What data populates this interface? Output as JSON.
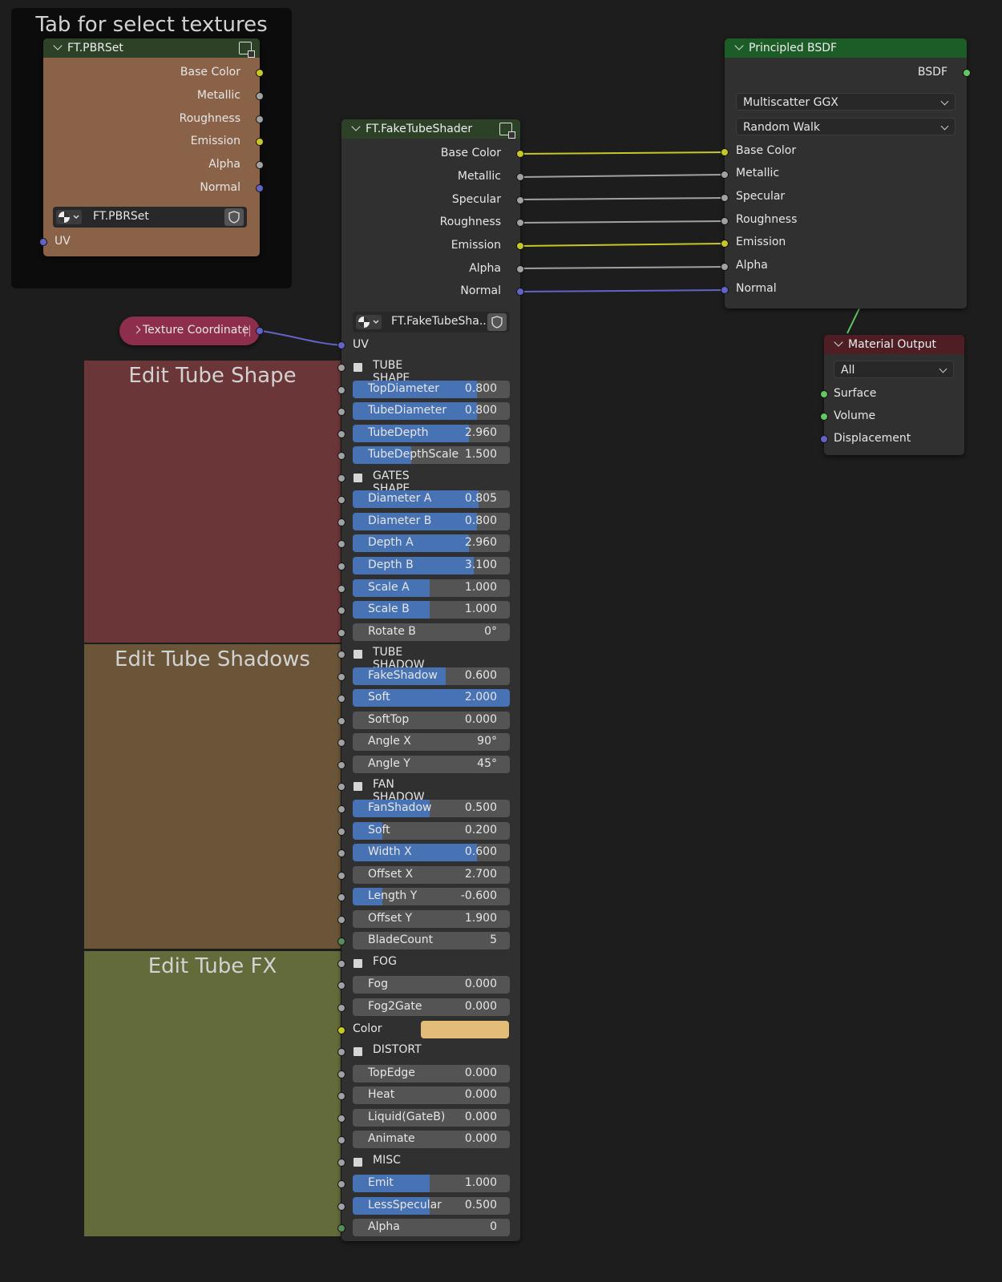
{
  "frames": {
    "textures_label": "Tab for select textures",
    "tube_shape_label": "Edit Tube Shape",
    "tube_shadows_label": "Edit Tube Shadows",
    "tube_fx_label": "Edit Tube FX"
  },
  "pbrset": {
    "title": "FT.PBRSet",
    "outputs": [
      "Base Color",
      "Metallic",
      "Roughness",
      "Emission",
      "Alpha",
      "Normal"
    ],
    "datablock": "FT.PBRSet",
    "input_uv": "UV"
  },
  "texcoord": {
    "title": "Texture Coordinate"
  },
  "faketube": {
    "title": "FT.FakeTubeShader",
    "outputs": [
      "Base Color",
      "Metallic",
      "Specular",
      "Roughness",
      "Emission",
      "Alpha",
      "Normal"
    ],
    "datablock": "FT.FakeTubeSha...",
    "input_uv": "UV",
    "tube_shape": {
      "title": "TUBE SHAPE",
      "fields": [
        {
          "label": "TopDiameter",
          "value": "0.800",
          "fill": 0.79
        },
        {
          "label": "TubeDiameter",
          "value": "0.800",
          "fill": 0.79
        },
        {
          "label": "TubeDepth",
          "value": "2.960",
          "fill": 0.74
        },
        {
          "label": "TubeDepthScale",
          "value": "1.500",
          "fill": 0.37
        }
      ]
    },
    "gates_shape": {
      "title": "GATES SHAPE",
      "fields": [
        {
          "label": "Diameter A",
          "value": "0.805",
          "fill": 0.8
        },
        {
          "label": "Diameter B",
          "value": "0.800",
          "fill": 0.79
        },
        {
          "label": "Depth A",
          "value": "2.960",
          "fill": 0.74
        },
        {
          "label": "Depth B",
          "value": "3.100",
          "fill": 0.77
        },
        {
          "label": "Scale A",
          "value": "1.000",
          "fill": 0.49
        },
        {
          "label": "Scale B",
          "value": "1.000",
          "fill": 0.49
        },
        {
          "label": "Rotate B",
          "value": "0°",
          "fill": 0
        }
      ]
    },
    "tube_shadow": {
      "title": "TUBE SHADOW",
      "fields": [
        {
          "label": "FakeShadow",
          "value": "0.600",
          "fill": 0.59
        },
        {
          "label": "Soft",
          "value": "2.000",
          "fill": 1.0
        },
        {
          "label": "SoftTop",
          "value": "0.000",
          "fill": 0
        },
        {
          "label": "Angle X",
          "value": "90°",
          "fill": 0
        },
        {
          "label": "Angle Y",
          "value": "45°",
          "fill": 0
        }
      ]
    },
    "fan_shadow": {
      "title": "FAN SHADOW",
      "fields": [
        {
          "label": "FanShadow",
          "value": "0.500",
          "fill": 0.49
        },
        {
          "label": "Soft",
          "value": "0.200",
          "fill": 0.19
        },
        {
          "label": "Width X",
          "value": "0.600",
          "fill": 0.79
        },
        {
          "label": "Offset X",
          "value": "2.700",
          "fill": 0
        },
        {
          "label": "Length Y",
          "value": "-0.600",
          "fill": 0.19
        },
        {
          "label": "Offset Y",
          "value": "1.900",
          "fill": 0
        },
        {
          "label": "BladeCount",
          "value": "5",
          "fill": 0
        }
      ]
    },
    "fog": {
      "title": "FOG",
      "fields": [
        {
          "label": "Fog",
          "value": "0.000",
          "fill": 0
        },
        {
          "label": "Fog2Gate",
          "value": "0.000",
          "fill": 0
        }
      ],
      "color_label": "Color",
      "color_value": "#e3bd78"
    },
    "distort": {
      "title": "DISTORT",
      "fields": [
        {
          "label": "TopEdge",
          "value": "0.000",
          "fill": 0
        },
        {
          "label": "Heat",
          "value": "0.000",
          "fill": 0
        },
        {
          "label": "Liquid(GateB)",
          "value": "0.000",
          "fill": 0
        },
        {
          "label": "Animate",
          "value": "0.000",
          "fill": 0
        }
      ]
    },
    "misc": {
      "title": "MISC",
      "fields": [
        {
          "label": "Emit",
          "value": "1.000",
          "fill": 0.49
        },
        {
          "label": "LessSpecular",
          "value": "0.500",
          "fill": 0.49
        },
        {
          "label": "Alpha",
          "value": "0",
          "fill": 0
        }
      ]
    }
  },
  "principled": {
    "title": "Principled BSDF",
    "output": "BSDF",
    "distribution": "Multiscatter GGX",
    "subsurface": "Random Walk",
    "inputs": [
      "Base Color",
      "Metallic",
      "Specular",
      "Roughness",
      "Emission",
      "Alpha",
      "Normal"
    ]
  },
  "matout": {
    "title": "Material Output",
    "target": "All",
    "inputs": [
      "Surface",
      "Volume",
      "Displacement"
    ]
  },
  "colors": {
    "yellow_socket": "#c7c729",
    "grey_socket": "#a1a1a1",
    "blue_socket": "#6363c7",
    "green_socket": "#63c763",
    "accent_blue": "#4772b3"
  }
}
